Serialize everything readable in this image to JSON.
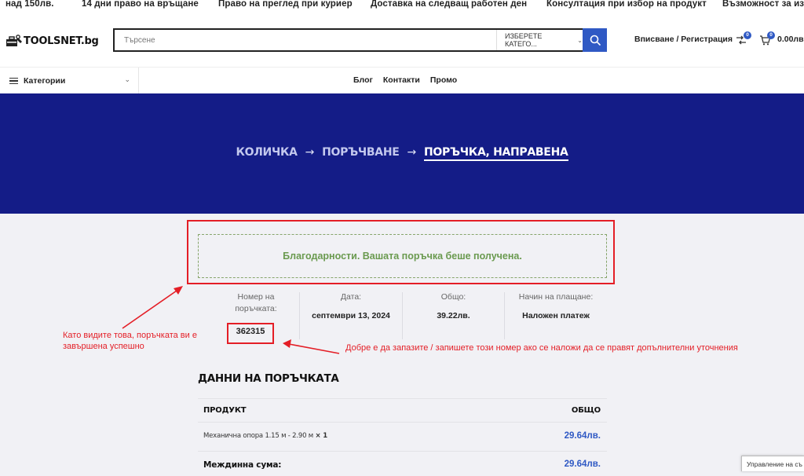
{
  "topbar": {
    "items": [
      "над 150лв.",
      "14 дни право на връщане",
      "Право на преглед при куриер",
      "Доставка на следващ работен ден",
      "Консултация при избор на продукт",
      "Възможност за изпл"
    ]
  },
  "header": {
    "logo_text": "TOOLSNET.bg",
    "search_placeholder": "Търсене",
    "category_select": "ИЗБЕРЕТЕ КАТЕГО...",
    "login_label": "Вписване / Регистрация",
    "compare_count": "0",
    "cart_count": "0",
    "cart_total": "0.00лв."
  },
  "nav": {
    "categories_label": "Категории",
    "links": [
      "Блог",
      "Контакти",
      "Промо"
    ]
  },
  "breadcrumb": {
    "step1": "КОЛИЧКА",
    "step2": "ПОРЪЧВАНЕ",
    "step3": "ПОРЪЧКА, НАПРАВЕНА",
    "separator": "→"
  },
  "notice": {
    "text": "Благодарности. Вашата поръчка беше получена."
  },
  "overview": {
    "order_number_label": "Номер на поръчката:",
    "order_number": "362315",
    "date_label": "Дата:",
    "date": "септември 13, 2024",
    "total_label": "Общо:",
    "total": "39.22лв.",
    "payment_label": "Начин на плащане:",
    "payment": "Наложен платеж"
  },
  "annotations": {
    "left": "Като видите това, поръчката ви е завършена успешно",
    "right": "Добре е да запазите / запишете този номер ако се наложи да се правят допълнителни уточнения",
    "color": "#e41e26"
  },
  "details": {
    "title": "ДАННИ НА ПОРЪЧКАТА",
    "col_product": "ПРОДУКТ",
    "col_total": "ОБЩО",
    "rows": [
      {
        "name": "Механична опора 1.15 м - 2.90 м",
        "qty": "× 1",
        "price": "29.64лв."
      }
    ],
    "subtotal_label": "Междинна сума:",
    "subtotal": "29.64лв."
  },
  "cookie": {
    "label": "Управление на съ"
  },
  "colors": {
    "banner": "#141c87",
    "accent": "#2f59c4",
    "success": "#6a9a4f"
  }
}
